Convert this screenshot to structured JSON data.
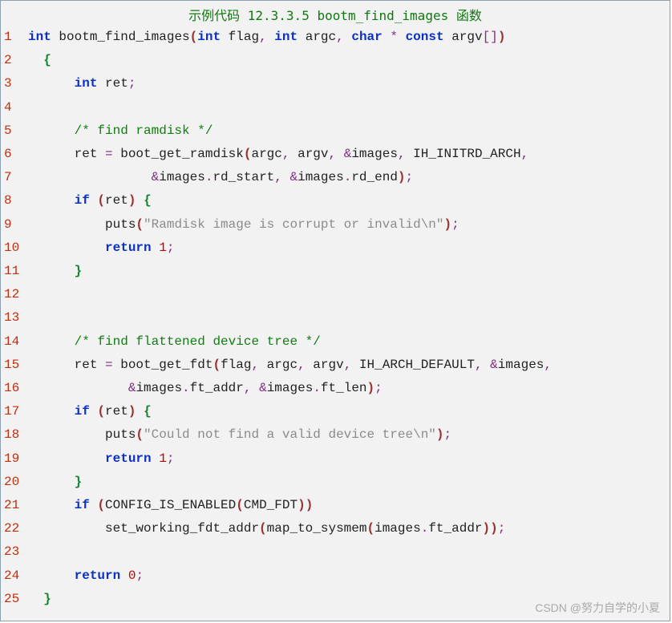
{
  "title": "示例代码 12.3.3.5 bootm_find_images 函数",
  "watermark": "CSDN @努力自学的小夏",
  "lines": [
    {
      "n": "1",
      "t": [
        [
          "kw",
          "int"
        ],
        [
          "pl",
          " bootm_find_images"
        ],
        [
          "rparen",
          "("
        ],
        [
          "kw",
          "int"
        ],
        [
          "pl",
          " flag"
        ],
        [
          "sym",
          ","
        ],
        [
          "pl",
          " "
        ],
        [
          "kw",
          "int"
        ],
        [
          "pl",
          " argc"
        ],
        [
          "sym",
          ","
        ],
        [
          "pl",
          " "
        ],
        [
          "kw",
          "char"
        ],
        [
          "pl",
          " "
        ],
        [
          "sym",
          "*"
        ],
        [
          "pl",
          " "
        ],
        [
          "kw",
          "const"
        ],
        [
          "pl",
          " argv"
        ],
        [
          "sym",
          "["
        ],
        [
          "sym",
          "]"
        ],
        [
          "rparen",
          ")"
        ]
      ]
    },
    {
      "n": "2",
      "t": [
        [
          "pl",
          "  "
        ],
        [
          "brace",
          "{"
        ]
      ]
    },
    {
      "n": "3",
      "t": [
        [
          "pl",
          "      "
        ],
        [
          "kw",
          "int"
        ],
        [
          "pl",
          " ret"
        ],
        [
          "sym",
          ";"
        ]
      ]
    },
    {
      "n": "4",
      "t": [
        [
          "pl",
          " "
        ]
      ]
    },
    {
      "n": "5",
      "t": [
        [
          "pl",
          "      "
        ],
        [
          "comment-green",
          "/* find ramdisk */"
        ]
      ]
    },
    {
      "n": "6",
      "t": [
        [
          "pl",
          "      ret "
        ],
        [
          "sym",
          "="
        ],
        [
          "pl",
          " boot_get_ramdisk"
        ],
        [
          "rparen",
          "("
        ],
        [
          "pl",
          "argc"
        ],
        [
          "sym",
          ","
        ],
        [
          "pl",
          " argv"
        ],
        [
          "sym",
          ","
        ],
        [
          "pl",
          " "
        ],
        [
          "sym",
          "&"
        ],
        [
          "pl",
          "images"
        ],
        [
          "sym",
          ","
        ],
        [
          "pl",
          " IH_INITRD_ARCH"
        ],
        [
          "sym",
          ","
        ]
      ]
    },
    {
      "n": "7",
      "t": [
        [
          "pl",
          "                "
        ],
        [
          "sym",
          "&"
        ],
        [
          "pl",
          "images"
        ],
        [
          "sym",
          "."
        ],
        [
          "pl",
          "rd_start"
        ],
        [
          "sym",
          ","
        ],
        [
          "pl",
          " "
        ],
        [
          "sym",
          "&"
        ],
        [
          "pl",
          "images"
        ],
        [
          "sym",
          "."
        ],
        [
          "pl",
          "rd_end"
        ],
        [
          "rparen",
          ")"
        ],
        [
          "sym",
          ";"
        ]
      ]
    },
    {
      "n": "8",
      "t": [
        [
          "pl",
          "      "
        ],
        [
          "kw",
          "if"
        ],
        [
          "pl",
          " "
        ],
        [
          "rparen",
          "("
        ],
        [
          "pl",
          "ret"
        ],
        [
          "rparen",
          ")"
        ],
        [
          "pl",
          " "
        ],
        [
          "brace",
          "{"
        ]
      ]
    },
    {
      "n": "9",
      "t": [
        [
          "pl",
          "          puts"
        ],
        [
          "rparen",
          "("
        ],
        [
          "str",
          "\"Ramdisk image is corrupt or invalid\\n\""
        ],
        [
          "rparen",
          ")"
        ],
        [
          "sym",
          ";"
        ]
      ]
    },
    {
      "n": "10",
      "t": [
        [
          "pl",
          "          "
        ],
        [
          "kw",
          "return"
        ],
        [
          "pl",
          " "
        ],
        [
          "num",
          "1"
        ],
        [
          "sym",
          ";"
        ]
      ]
    },
    {
      "n": "11",
      "t": [
        [
          "pl",
          "      "
        ],
        [
          "brace",
          "}"
        ]
      ]
    },
    {
      "n": "12",
      "t": [
        [
          "pl",
          " "
        ]
      ]
    },
    {
      "n": "13",
      "t": [
        [
          "pl",
          " "
        ]
      ]
    },
    {
      "n": "14",
      "t": [
        [
          "pl",
          "      "
        ],
        [
          "comment-green",
          "/* find flattened device tree */"
        ]
      ]
    },
    {
      "n": "15",
      "t": [
        [
          "pl",
          "      ret "
        ],
        [
          "sym",
          "="
        ],
        [
          "pl",
          " boot_get_fdt"
        ],
        [
          "rparen",
          "("
        ],
        [
          "pl",
          "flag"
        ],
        [
          "sym",
          ","
        ],
        [
          "pl",
          " argc"
        ],
        [
          "sym",
          ","
        ],
        [
          "pl",
          " argv"
        ],
        [
          "sym",
          ","
        ],
        [
          "pl",
          " IH_ARCH_DEFAULT"
        ],
        [
          "sym",
          ","
        ],
        [
          "pl",
          " "
        ],
        [
          "sym",
          "&"
        ],
        [
          "pl",
          "images"
        ],
        [
          "sym",
          ","
        ]
      ]
    },
    {
      "n": "16",
      "t": [
        [
          "pl",
          "             "
        ],
        [
          "sym",
          "&"
        ],
        [
          "pl",
          "images"
        ],
        [
          "sym",
          "."
        ],
        [
          "pl",
          "ft_addr"
        ],
        [
          "sym",
          ","
        ],
        [
          "pl",
          " "
        ],
        [
          "sym",
          "&"
        ],
        [
          "pl",
          "images"
        ],
        [
          "sym",
          "."
        ],
        [
          "pl",
          "ft_len"
        ],
        [
          "rparen",
          ")"
        ],
        [
          "sym",
          ";"
        ]
      ]
    },
    {
      "n": "17",
      "t": [
        [
          "pl",
          "      "
        ],
        [
          "kw",
          "if"
        ],
        [
          "pl",
          " "
        ],
        [
          "rparen",
          "("
        ],
        [
          "pl",
          "ret"
        ],
        [
          "rparen",
          ")"
        ],
        [
          "pl",
          " "
        ],
        [
          "brace",
          "{"
        ]
      ]
    },
    {
      "n": "18",
      "t": [
        [
          "pl",
          "          puts"
        ],
        [
          "rparen",
          "("
        ],
        [
          "str",
          "\"Could not find a valid device tree\\n\""
        ],
        [
          "rparen",
          ")"
        ],
        [
          "sym",
          ";"
        ]
      ]
    },
    {
      "n": "19",
      "t": [
        [
          "pl",
          "          "
        ],
        [
          "kw",
          "return"
        ],
        [
          "pl",
          " "
        ],
        [
          "num",
          "1"
        ],
        [
          "sym",
          ";"
        ]
      ]
    },
    {
      "n": "20",
      "t": [
        [
          "pl",
          "      "
        ],
        [
          "brace",
          "}"
        ]
      ]
    },
    {
      "n": "21",
      "t": [
        [
          "pl",
          "      "
        ],
        [
          "kw",
          "if"
        ],
        [
          "pl",
          " "
        ],
        [
          "rparen",
          "("
        ],
        [
          "pl",
          "CONFIG_IS_ENABLED"
        ],
        [
          "rparen",
          "("
        ],
        [
          "pl",
          "CMD_FDT"
        ],
        [
          "rparen",
          ")"
        ],
        [
          "rparen",
          ")"
        ]
      ]
    },
    {
      "n": "22",
      "t": [
        [
          "pl",
          "          set_working_fdt_addr"
        ],
        [
          "rparen",
          "("
        ],
        [
          "pl",
          "map_to_sysmem"
        ],
        [
          "rparen",
          "("
        ],
        [
          "pl",
          "images"
        ],
        [
          "sym",
          "."
        ],
        [
          "pl",
          "ft_addr"
        ],
        [
          "rparen",
          ")"
        ],
        [
          "rparen",
          ")"
        ],
        [
          "sym",
          ";"
        ]
      ]
    },
    {
      "n": "23",
      "t": [
        [
          "pl",
          " "
        ]
      ]
    },
    {
      "n": "24",
      "t": [
        [
          "pl",
          "      "
        ],
        [
          "kw",
          "return"
        ],
        [
          "pl",
          " "
        ],
        [
          "num",
          "0"
        ],
        [
          "sym",
          ";"
        ]
      ]
    },
    {
      "n": "25",
      "t": [
        [
          "pl",
          "  "
        ],
        [
          "brace",
          "}"
        ]
      ]
    }
  ]
}
